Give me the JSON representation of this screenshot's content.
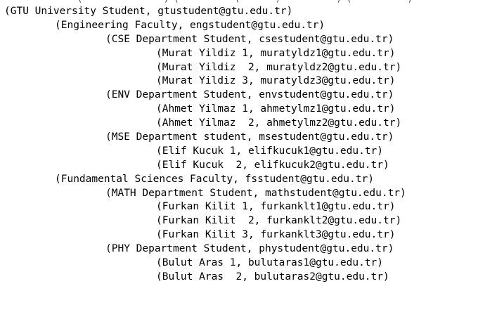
{
  "top_partial": "(                ) (           (       )           ) (           )",
  "lines": [
    {
      "depth": 0,
      "text": "(GTU University Student, gtustudent@gtu.edu.tr)"
    },
    {
      "depth": 1,
      "text": "(Engineering Faculty, engstudent@gtu.edu.tr)"
    },
    {
      "depth": 2,
      "text": "(CSE Department Student, csestudent@gtu.edu.tr)"
    },
    {
      "depth": 3,
      "text": "(Murat Yildiz 1, muratyldz1@gtu.edu.tr)"
    },
    {
      "depth": 3,
      "text": "(Murat Yildiz  2, muratyldz2@gtu.edu.tr)"
    },
    {
      "depth": 3,
      "text": "(Murat Yildiz 3, muratyldz3@gtu.edu.tr)"
    },
    {
      "depth": 2,
      "text": "(ENV Department Student, envstudent@gtu.edu.tr)"
    },
    {
      "depth": 3,
      "text": "(Ahmet Yilmaz 1, ahmetylmz1@gtu.edu.tr)"
    },
    {
      "depth": 3,
      "text": "(Ahmet Yilmaz  2, ahmetylmz2@gtu.edu.tr)"
    },
    {
      "depth": 2,
      "text": "(MSE Department student, msestudent@gtu.edu.tr)"
    },
    {
      "depth": 3,
      "text": "(Elif Kucuk 1, elifkucuk1@gtu.edu.tr)"
    },
    {
      "depth": 3,
      "text": "(Elif Kucuk  2, elifkucuk2@gtu.edu.tr)"
    },
    {
      "depth": 1,
      "text": "(Fundamental Sciences Faculty, fsstudent@gtu.edu.tr)"
    },
    {
      "depth": 2,
      "text": "(MATH Department Student, mathstudent@gtu.edu.tr)"
    },
    {
      "depth": 3,
      "text": "(Furkan Kilit 1, furkanklt1@gtu.edu.tr)"
    },
    {
      "depth": 3,
      "text": "(Furkan Kilit  2, furkanklt2@gtu.edu.tr)"
    },
    {
      "depth": 3,
      "text": "(Furkan Kilit 3, furkanklt3@gtu.edu.tr)"
    },
    {
      "depth": 2,
      "text": "(PHY Department Student, phystudent@gtu.edu.tr)"
    },
    {
      "depth": 3,
      "text": "(Bulut Aras 1, bulutaras1@gtu.edu.tr)"
    },
    {
      "depth": 3,
      "text": "(Bulut Aras  2, bulutaras2@gtu.edu.tr)"
    }
  ]
}
